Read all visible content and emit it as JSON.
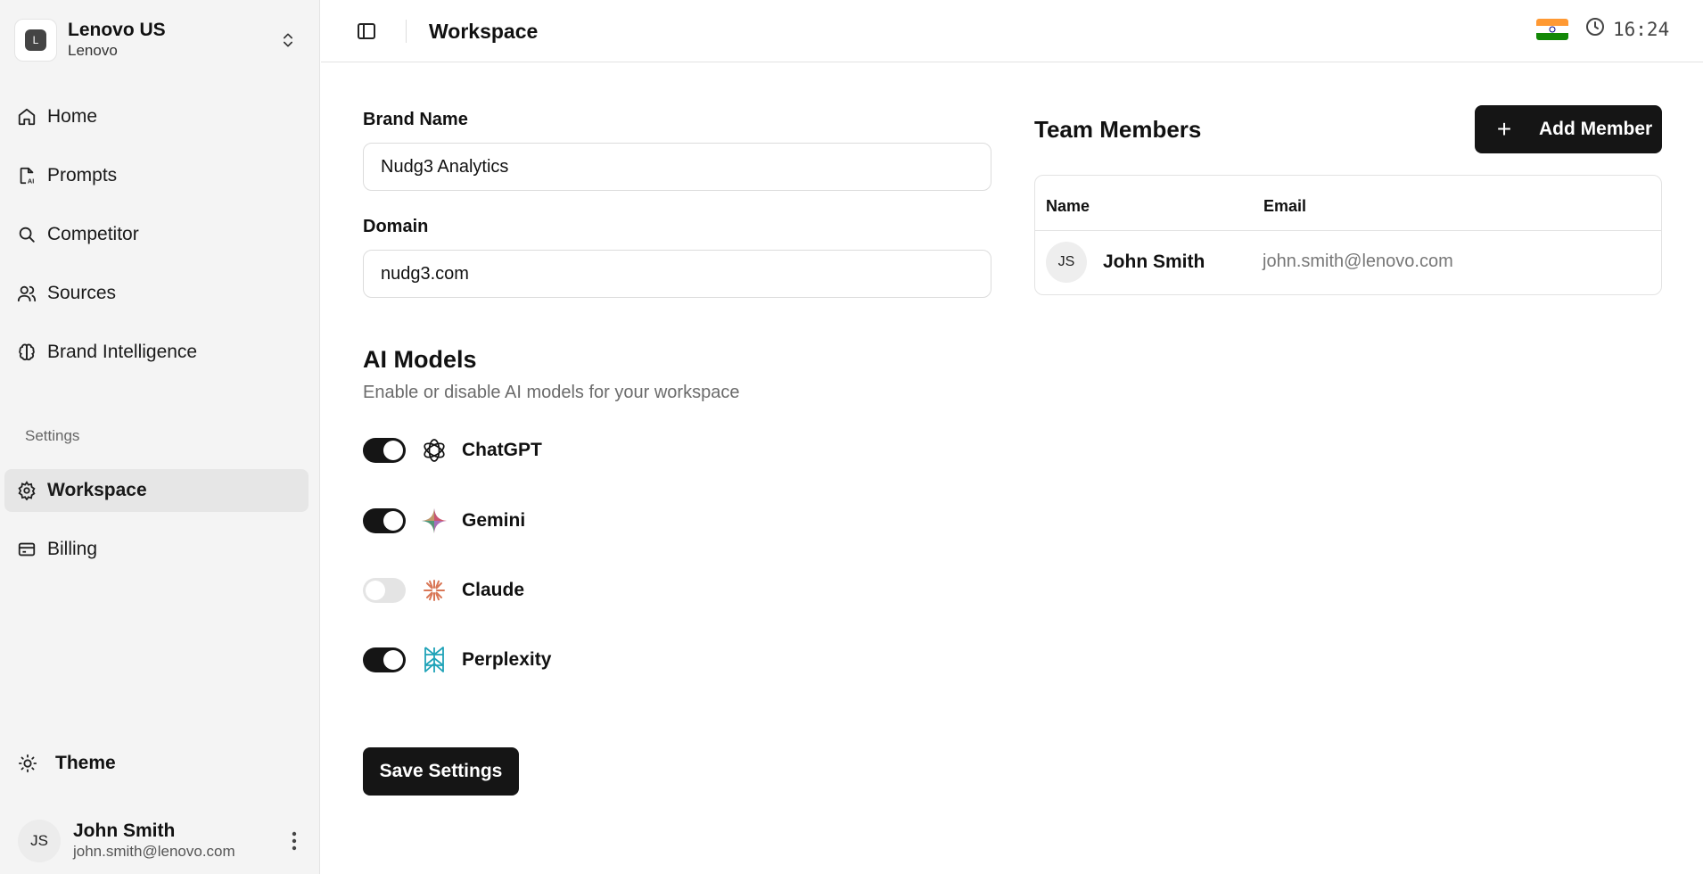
{
  "org": {
    "name": "Lenovo US",
    "subtitle": "Lenovo",
    "logo_letter": "L"
  },
  "nav": {
    "items": [
      {
        "label": "Home",
        "icon": "home-icon"
      },
      {
        "label": "Prompts",
        "icon": "file-ai-icon"
      },
      {
        "label": "Competitor",
        "icon": "search-icon"
      },
      {
        "label": "Sources",
        "icon": "users-icon"
      },
      {
        "label": "Brand Intelligence",
        "icon": "brain-icon"
      }
    ],
    "settings_label": "Settings",
    "settings_items": [
      {
        "label": "Workspace",
        "icon": "gear-icon",
        "active": true
      },
      {
        "label": "Billing",
        "icon": "credit-card-icon",
        "active": false
      }
    ],
    "theme_label": "Theme"
  },
  "user": {
    "initials": "JS",
    "name": "John Smith",
    "email": "john.smith@lenovo.com"
  },
  "header": {
    "title": "Workspace",
    "time": "16:24",
    "flag_colors": [
      "#FF9933",
      "#FFFFFF",
      "#138808"
    ]
  },
  "form": {
    "brand_label": "Brand Name",
    "brand_value": "Nudg3 Analytics",
    "domain_label": "Domain",
    "domain_value": "nudg3.com"
  },
  "ai_models": {
    "title": "AI Models",
    "subtitle": "Enable or disable AI models for your workspace",
    "models": [
      {
        "name": "ChatGPT",
        "enabled": true,
        "icon": "openai-icon"
      },
      {
        "name": "Gemini",
        "enabled": true,
        "icon": "gemini-icon"
      },
      {
        "name": "Claude",
        "enabled": false,
        "icon": "claude-icon"
      },
      {
        "name": "Perplexity",
        "enabled": true,
        "icon": "perplexity-icon"
      }
    ]
  },
  "save_label": "Save Settings",
  "team": {
    "title": "Team Members",
    "add_label": "Add Member",
    "columns": [
      "Name",
      "Email"
    ],
    "members": [
      {
        "initials": "JS",
        "name": "John Smith",
        "email": "john.smith@lenovo.com"
      }
    ]
  },
  "colors": {
    "accent": "#151515",
    "sidebar_bg": "#f4f4f4",
    "active_bg": "#e6e6e6",
    "claude": "#D97757",
    "perplexity": "#20A3B8"
  }
}
